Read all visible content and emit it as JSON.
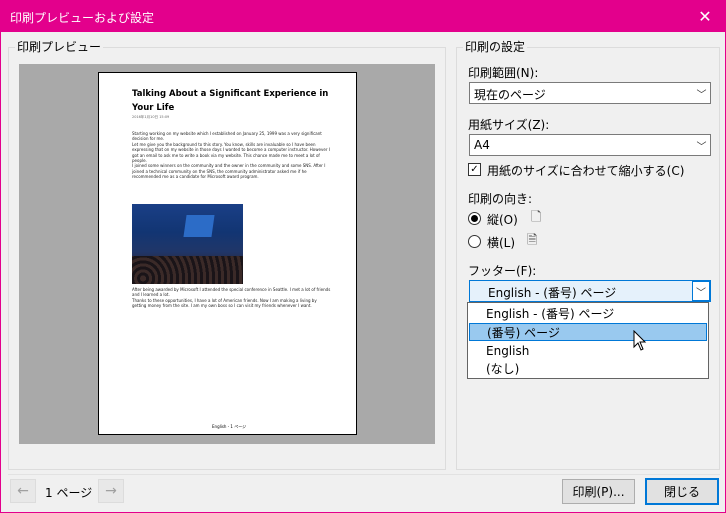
{
  "window": {
    "title": "印刷プレビューおよび設定",
    "close_glyph": "✕"
  },
  "preview": {
    "group_label": "印刷プレビュー",
    "page": {
      "title": "Talking About a Significant Experience in Your Life",
      "meta": "2016年1月10日     15:09",
      "paragraphs": [
        "Starting working on my website which I established on January 25, 1999 was a very significant decision for me.",
        "Let me give you the background to this story. You know, skills are invaluable so I have been expressing that on my website in those days I wanted to become a computer instructor. However I got an email to ask me to write a book via my website. This chance made me to meet a lot of people.",
        "I joined some winners on the community and the owner in the community and some SNS. After I joined a technical community on the SNS, the community administrator asked me if he recommended me as a candidate for Microsoft award program."
      ],
      "paragraphs2": [
        "After being awarded by Microsoft I attended the special conference in Seattle. I met a lot of friends and I learned a lot.",
        "Thanks to these opportunities, I have a lot of American friends. Now I am making a living by getting money from the site. I am my own boss so I can visit my friends whenever I want."
      ],
      "footer": "English - 1 ページ"
    }
  },
  "navigation": {
    "prev_glyph": "←",
    "next_glyph": "→",
    "page_label": "1 ページ"
  },
  "settings": {
    "group_label": "印刷の設定",
    "print_range": {
      "label": "印刷範囲(N):",
      "value": "現在のページ"
    },
    "paper_size": {
      "label": "用紙サイズ(Z):",
      "value": "A4"
    },
    "fit_to_paper": {
      "label": "用紙のサイズに合わせて縮小する(C)",
      "checked": true,
      "check_glyph": "✓"
    },
    "orientation": {
      "label": "印刷の向き:",
      "portrait": "縦(O)",
      "landscape": "横(L)",
      "selected": "portrait"
    },
    "footer": {
      "label": "フッター(F):",
      "value": "English - (番号) ページ",
      "options": [
        "English - (番号) ページ",
        "(番号) ページ",
        "English",
        "(なし)"
      ],
      "highlighted_index": 1
    }
  },
  "buttons": {
    "print": "印刷(P)...",
    "close": "閉じる"
  },
  "icons": {
    "dropdown_arrow": "﹀",
    "portrait_doc": "🗋",
    "landscape_doc": "🗎"
  }
}
